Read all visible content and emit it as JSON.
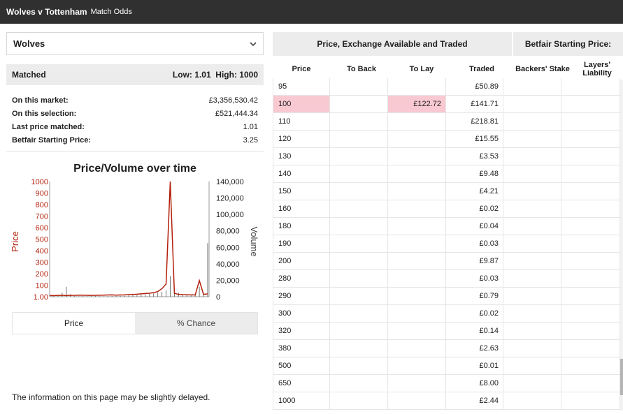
{
  "header": {
    "event": "Wolves v Tottenham",
    "market": "Match Odds"
  },
  "selection": {
    "value": "Wolves",
    "icon": "chevron-down-icon"
  },
  "matched": {
    "label": "Matched",
    "low_label": "Low:",
    "low_value": "1.01",
    "high_label": "High:",
    "high_value": "1000"
  },
  "stats": [
    {
      "label": "On this market:",
      "value": "£3,356,530.42"
    },
    {
      "label": "On this selection:",
      "value": "£521,444.34"
    },
    {
      "label": "Last price matched:",
      "value": "1.01"
    },
    {
      "label": "Betfair Starting Price:",
      "value": "3.25"
    }
  ],
  "chart_data": {
    "type": "line",
    "title": "Price/Volume over time",
    "ylabel": "Price",
    "y2label": "Volume",
    "price_ticks": [
      "1.00",
      "100",
      "200",
      "300",
      "400",
      "500",
      "600",
      "700",
      "800",
      "900",
      "1000"
    ],
    "volume_ticks": [
      "0",
      "20,000",
      "40,000",
      "60,000",
      "80,000",
      "100,000",
      "120,000",
      "140,000"
    ],
    "ylim": [
      0,
      1000
    ],
    "y2lim": [
      0,
      140000
    ],
    "series": [
      {
        "color": "#b21f0a",
        "values": [
          10,
          10,
          11,
          12,
          10,
          11,
          12,
          14,
          13,
          12,
          11,
          12,
          13,
          14,
          15,
          16,
          14,
          15,
          16,
          18,
          20,
          22,
          25,
          28,
          30,
          35,
          45,
          70,
          110,
          1000,
          30,
          20,
          18,
          17,
          16,
          15,
          140,
          20,
          25
        ]
      },
      {
        "color": "#707070",
        "values": [
          0,
          1000,
          2000,
          5000,
          12000,
          3000,
          1000,
          500,
          800,
          600,
          700,
          900,
          600,
          500,
          700,
          800,
          900,
          1000,
          1200,
          1500,
          1800,
          2000,
          2500,
          3000,
          3500,
          4000,
          5000,
          6000,
          8000,
          25000,
          9000,
          5000,
          3000,
          2000,
          1500,
          2000,
          12000,
          5000,
          65000
        ]
      }
    ],
    "series_colors": {
      "price": "#b21f0a",
      "volume": "#707070"
    }
  },
  "toggle": {
    "price": "Price",
    "chance": "% Chance"
  },
  "notice": "The information on this page may be slightly delayed.",
  "ladder": {
    "group_header": "Price, Exchange Available and Traded",
    "sp_header": "Betfair Starting Price:",
    "columns": {
      "price": "Price",
      "to_back": "To Back",
      "to_lay": "To Lay",
      "traded": "Traded",
      "backers_stake": "Backers' Stake",
      "layers_liability": "Layers' Liability"
    },
    "rows": [
      {
        "price": "95",
        "to_back": "",
        "to_lay": "",
        "traded": "£50.89"
      },
      {
        "price": "100",
        "to_back": "",
        "to_lay": "£122.72",
        "traded": "£141.71"
      },
      {
        "price": "110",
        "to_back": "",
        "to_lay": "",
        "traded": "£218.81"
      },
      {
        "price": "120",
        "to_back": "",
        "to_lay": "",
        "traded": "£15.55"
      },
      {
        "price": "130",
        "to_back": "",
        "to_lay": "",
        "traded": "£3.53"
      },
      {
        "price": "140",
        "to_back": "",
        "to_lay": "",
        "traded": "£9.48"
      },
      {
        "price": "150",
        "to_back": "",
        "to_lay": "",
        "traded": "£4.21"
      },
      {
        "price": "160",
        "to_back": "",
        "to_lay": "",
        "traded": "£0.02"
      },
      {
        "price": "180",
        "to_back": "",
        "to_lay": "",
        "traded": "£0.04"
      },
      {
        "price": "190",
        "to_back": "",
        "to_lay": "",
        "traded": "£0.03"
      },
      {
        "price": "200",
        "to_back": "",
        "to_lay": "",
        "traded": "£9.87"
      },
      {
        "price": "280",
        "to_back": "",
        "to_lay": "",
        "traded": "£0.03"
      },
      {
        "price": "290",
        "to_back": "",
        "to_lay": "",
        "traded": "£0.79"
      },
      {
        "price": "300",
        "to_back": "",
        "to_lay": "",
        "traded": "£0.02"
      },
      {
        "price": "320",
        "to_back": "",
        "to_lay": "",
        "traded": "£0.14"
      },
      {
        "price": "380",
        "to_back": "",
        "to_lay": "",
        "traded": "£2.63"
      },
      {
        "price": "500",
        "to_back": "",
        "to_lay": "",
        "traded": "£0.01"
      },
      {
        "price": "650",
        "to_back": "",
        "to_lay": "",
        "traded": "£8.00"
      },
      {
        "price": "1000",
        "to_back": "",
        "to_lay": "",
        "traded": "£2.44"
      }
    ],
    "highlight_color": "#f9c9d2"
  }
}
